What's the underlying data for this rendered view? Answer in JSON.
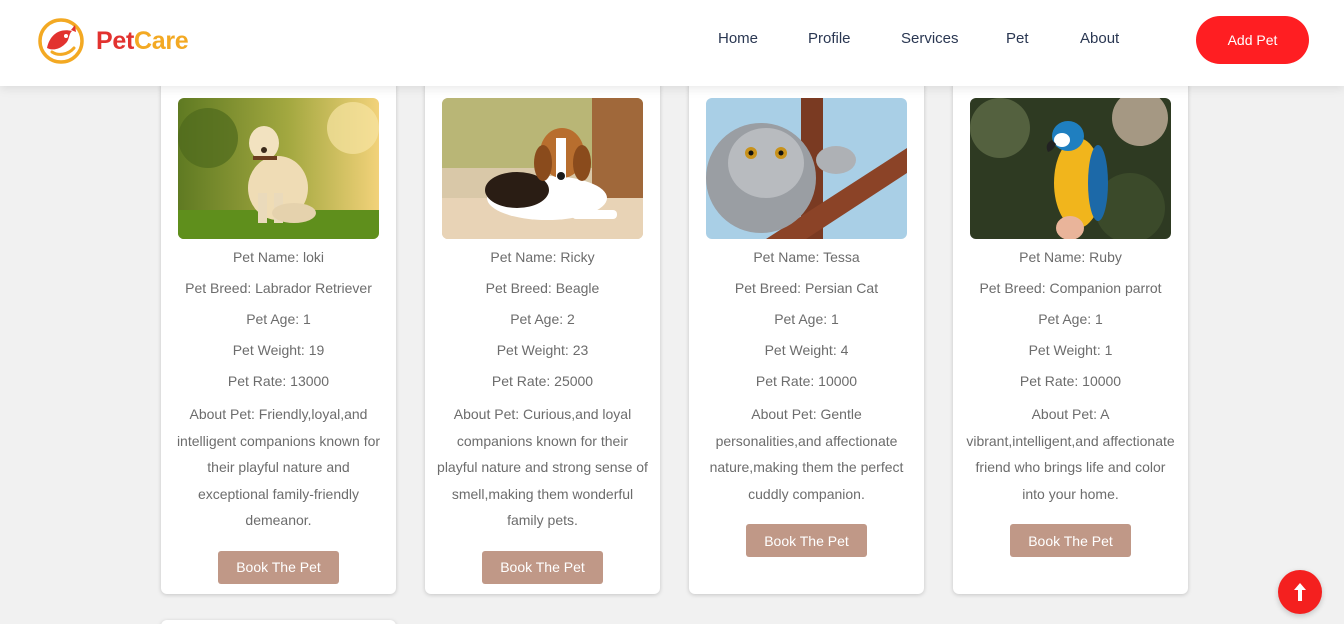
{
  "header": {
    "logo": {
      "word1": "Pet",
      "word2": "Care"
    },
    "nav": [
      "Home",
      "Profile",
      "Services",
      "Pet",
      "About"
    ],
    "add_pet_label": "Add Pet"
  },
  "pets": [
    {
      "name": "Pet Name: loki",
      "breed": "Pet Breed: Labrador Retriever",
      "age": "Pet Age: 1",
      "weight": "Pet Weight: 19",
      "rate": "Pet Rate: 13000",
      "about": "About Pet: Friendly,loyal,and intelligent companions known for their playful nature and exceptional family-friendly demeanor.",
      "button": "Book The Pet",
      "image": "labrador-photo"
    },
    {
      "name": "Pet Name: Ricky",
      "breed": "Pet Breed: Beagle",
      "age": "Pet Age: 2",
      "weight": "Pet Weight: 23",
      "rate": "Pet Rate: 25000",
      "about": "About Pet: Curious,and loyal companions known for their playful nature and strong sense of smell,making them wonderful family pets.",
      "button": "Book The Pet",
      "image": "beagle-photo"
    },
    {
      "name": "Pet Name: Tessa",
      "breed": "Pet Breed: Persian Cat",
      "age": "Pet Age: 1",
      "weight": "Pet Weight: 4",
      "rate": "Pet Rate: 10000",
      "about": "About Pet: Gentle personalities,and affectionate nature,making them the perfect cuddly companion.",
      "button": "Book The Pet",
      "image": "persian-cat-photo"
    },
    {
      "name": "Pet Name: Ruby",
      "breed": "Pet Breed: Companion parrot",
      "age": "Pet Age: 1",
      "weight": "Pet Weight: 1",
      "rate": "Pet Rate: 10000",
      "about": "About Pet: A vibrant,intelligent,and affectionate friend who brings life and color into your home.",
      "button": "Book The Pet",
      "image": "parrot-photo"
    }
  ],
  "colors": {
    "brand_red": "#ff1e22",
    "logo_red": "#e2322f",
    "logo_yellow": "#f3a923",
    "book_button": "#c09887",
    "nav_text": "#2a3752"
  },
  "icons": {
    "scroll_top": "arrow-up-icon"
  }
}
